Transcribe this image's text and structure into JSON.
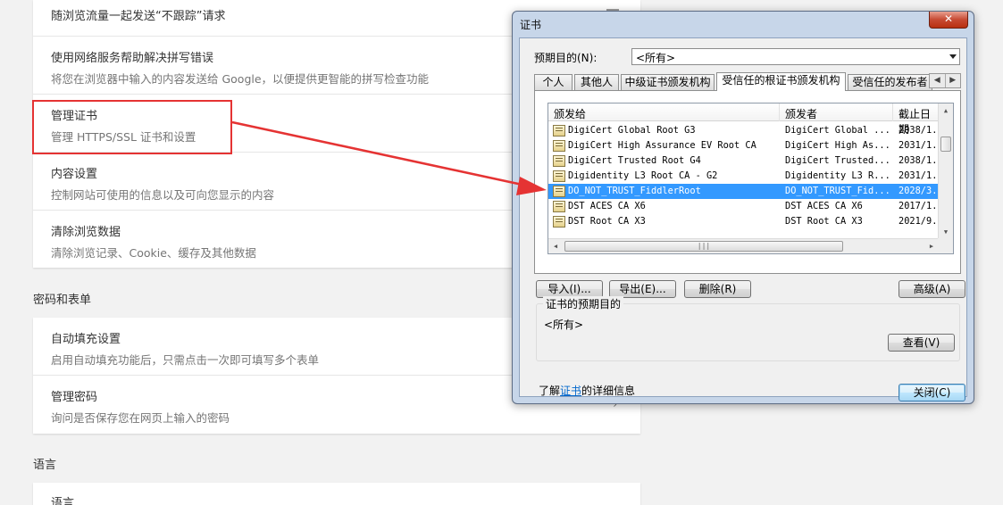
{
  "settings": {
    "top_card": [
      {
        "title": "随浏览流量一起发送“不跟踪”请求",
        "desc": ""
      },
      {
        "title": "使用网络服务帮助解决拼写错误",
        "desc": "将您在浏览器中输入的内容发送给 Google，以便提供更智能的拼写检查功能"
      },
      {
        "title": "管理证书",
        "desc": "管理 HTTPS/SSL 证书和设置"
      },
      {
        "title": "内容设置",
        "desc": "控制网站可使用的信息以及可向您显示的内容"
      },
      {
        "title": "清除浏览数据",
        "desc": "清除浏览记录、Cookie、缓存及其他数据"
      }
    ],
    "passwords_section": "密码和表单",
    "passwords_card": [
      {
        "title": "自动填充设置",
        "desc": "启用自动填充功能后，只需点击一次即可填写多个表单"
      },
      {
        "title": "管理密码",
        "desc": "询问是否保存您在网页上输入的密码"
      }
    ],
    "language_section": "语言",
    "language_card": [
      {
        "title": "语言",
        "desc": ""
      }
    ]
  },
  "dialog": {
    "title": "证书",
    "close_symbol": "✕",
    "purpose_label": "预期目的(N):",
    "purpose_value": "<所有>",
    "tabs": [
      "个人",
      "其他人",
      "中级证书颁发机构",
      "受信任的根证书颁发机构",
      "受信任的发布者"
    ],
    "tab_scroll": [
      "◀",
      "▶"
    ],
    "columns": [
      "颁发给",
      "颁发者",
      "截止日期"
    ],
    "rows": [
      {
        "issued_to": "DigiCert Global Root G3",
        "issued_by": "DigiCert Global ...",
        "expires": "2038/1..."
      },
      {
        "issued_to": "DigiCert High Assurance EV Root CA",
        "issued_by": "DigiCert High As...",
        "expires": "2031/1..."
      },
      {
        "issued_to": "DigiCert Trusted Root G4",
        "issued_by": "DigiCert Trusted...",
        "expires": "2038/1..."
      },
      {
        "issued_to": "Digidentity L3 Root CA - G2",
        "issued_by": "Digidentity L3 R...",
        "expires": "2031/1..."
      },
      {
        "issued_to": "DO_NOT_TRUST_FiddlerRoot",
        "issued_by": "DO_NOT_TRUST_Fid...",
        "expires": "2028/3..."
      },
      {
        "issued_to": "DST ACES CA X6",
        "issued_by": "DST ACES CA X6",
        "expires": "2017/1..."
      },
      {
        "issued_to": "DST Root CA X3",
        "issued_by": "DST Root CA X3",
        "expires": "2021/9..."
      }
    ],
    "selected_index": 4,
    "buttons": {
      "import": "导入(I)...",
      "export": "导出(E)...",
      "remove": "删除(R)",
      "advanced": "高级(A)",
      "view": "查看(V)",
      "close": "关闭(C)"
    },
    "purposes_group_title": "证书的预期目的",
    "purposes_value": "<所有>",
    "footer_prefix": "了解",
    "footer_link": "证书",
    "footer_suffix": "的详细信息"
  },
  "colors": {
    "highlight": "#e53333",
    "selection": "#3399ff",
    "link": "#0066cc"
  }
}
